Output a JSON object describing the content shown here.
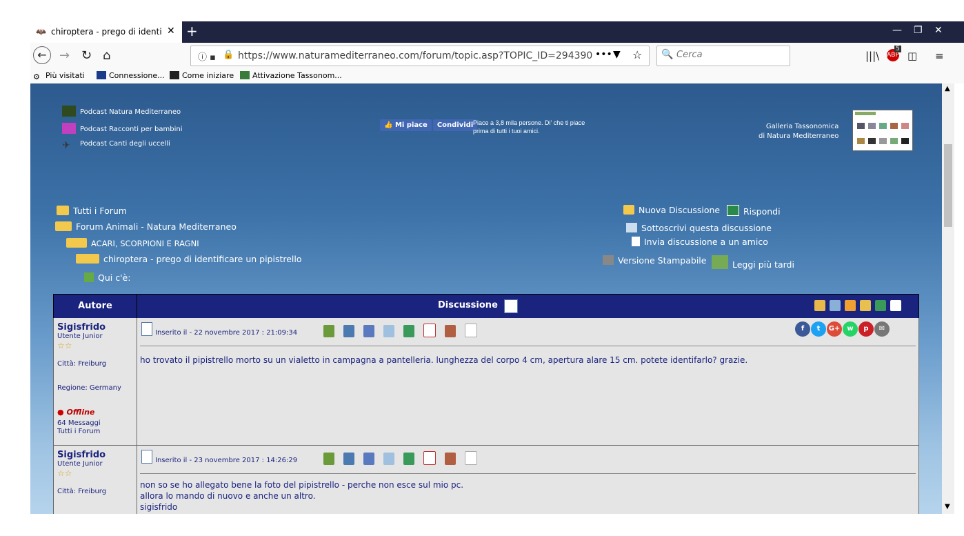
{
  "browser": {
    "tab_title": "chiroptera - prego di identificar",
    "tab_close": "✕",
    "new_tab": "+",
    "url": "https://www.naturamediterraneo.com/forum/topic.asp?TOPIC_ID=294390",
    "search_placeholder": "Cerca",
    "adblock_count": "5",
    "bookmarks": [
      "Più visitati",
      "Connessione...",
      "Come iniziare",
      "Attivazione Tassonom..."
    ]
  },
  "header": {
    "podcasts": [
      "Podcast Natura Mediterraneo",
      "Podcast Racconti per bambini",
      "Podcast Canti degli uccelli"
    ],
    "fb_like": "Mi piace",
    "fb_share": "Condividi",
    "fb_text": "Piace a 3,8 mila persone. Di' che ti piace prima di tutti i tuoi amici.",
    "gallery_line1": "Galleria Tassonomica",
    "gallery_line2": "di Natura Mediterraneo"
  },
  "breadcrumb": [
    "Tutti i Forum",
    "Forum Animali - Natura Mediterraneo",
    "ACARI, SCORPIONI E RAGNI",
    "chiroptera - prego di identificare un pipistrello",
    "Qui c'è:"
  ],
  "actions": {
    "new_topic": "Nuova Discussione",
    "reply": "Rispondi",
    "subscribe": "Sottoscrivi questa discussione",
    "send_friend": "Invia discussione a un amico",
    "printable": "Versione Stampabile",
    "read_later": "Leggi più tardi"
  },
  "table": {
    "col_author": "Autore",
    "col_discussion": "Discussione",
    "posts": [
      {
        "author": "Sigisfrido",
        "role": "Utente Junior",
        "stars": "☆☆",
        "city": "Città: Freiburg",
        "region": "Regione: Germany",
        "status": "Offline",
        "messages": "64 Messaggi",
        "forums": "Tutti i Forum",
        "posted": "Inserito il - 22 novembre 2017 : 21:09:34",
        "text": [
          "ho trovato il pipistrello morto su un vialetto in campagna a pantelleria. lunghezza del corpo 4 cm, apertura alare 15 cm. potete identifarlo? grazie."
        ]
      },
      {
        "author": "Sigisfrido",
        "role": "Utente Junior",
        "stars": "☆☆",
        "city": "Città: Freiburg",
        "posted": "Inserito il - 23 novembre 2017 : 14:26:29",
        "text": [
          "non so se ho allegato bene la foto del pipistrello - perche non esce sul mio pc.",
          "allora lo mando di nuovo e anche un altro.",
          "sigisfrido"
        ]
      }
    ]
  },
  "social": [
    "f",
    "t",
    "G+",
    "w",
    "p",
    "✉"
  ],
  "colors": {
    "header_navy": "#1a237e",
    "facebook": "#3b5998",
    "twitter": "#1da1f2",
    "googleplus": "#dd4b39",
    "whatsapp": "#25d366",
    "pinterest": "#cb2027",
    "email": "#777777"
  }
}
